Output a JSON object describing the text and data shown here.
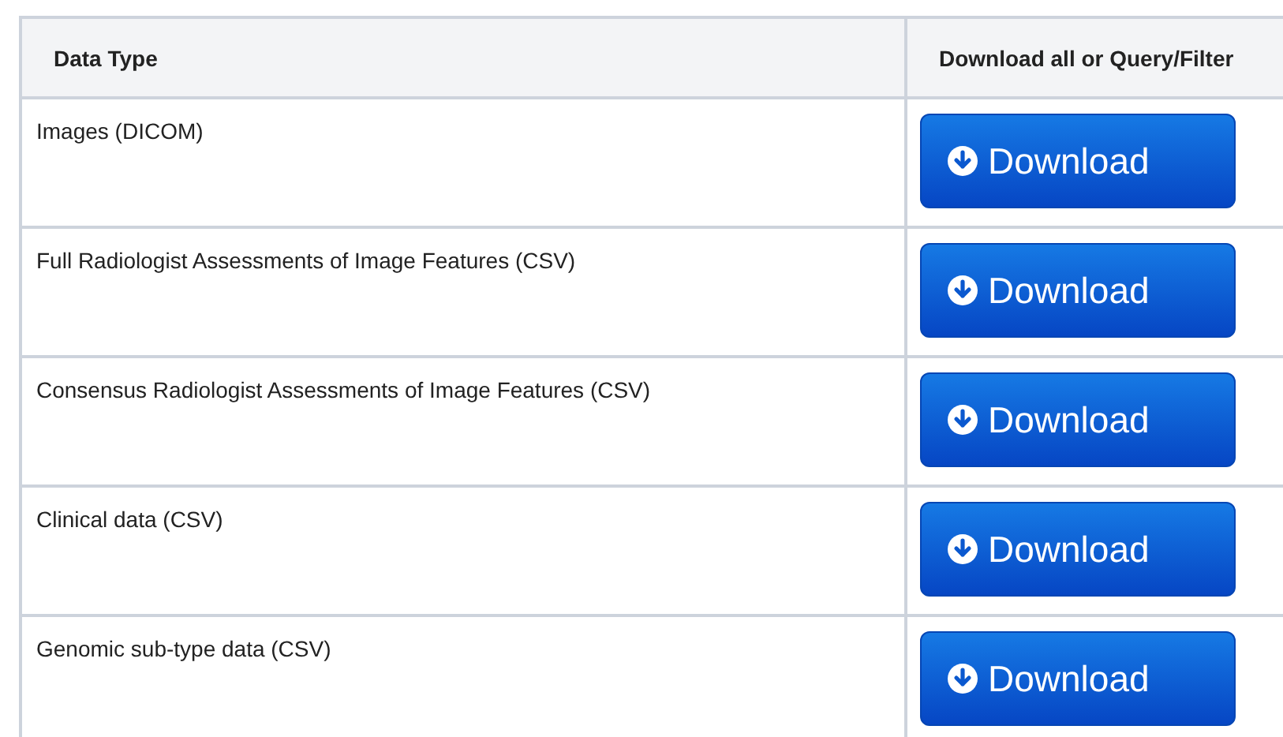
{
  "table": {
    "columns": [
      "Data Type",
      "Download all or Query/Filter"
    ],
    "rows": [
      {
        "data_type": "Images (DICOM)",
        "button": "Download"
      },
      {
        "data_type": "Full Radiologist Assessments of Image Features  (CSV)",
        "button": "Download"
      },
      {
        "data_type": "Consensus Radiologist Assessments of Image Features  (CSV)",
        "button": "Download"
      },
      {
        "data_type": "Clinical data (CSV)",
        "button": "Download"
      },
      {
        "data_type": "Genomic sub-type data (CSV)",
        "button": "Download"
      }
    ]
  }
}
